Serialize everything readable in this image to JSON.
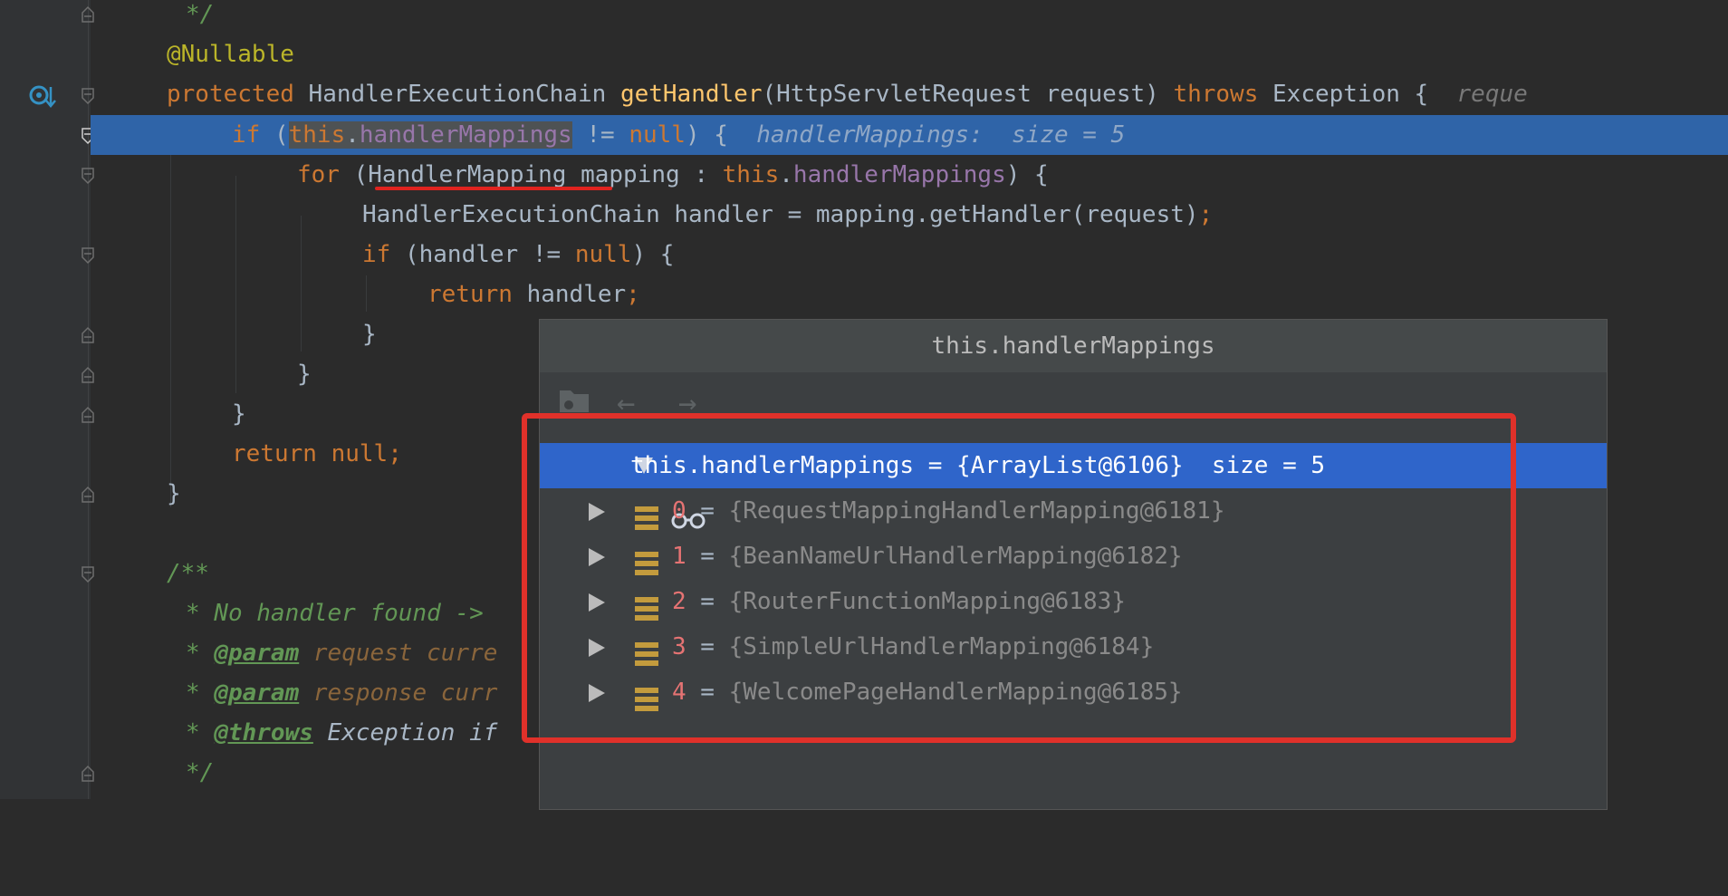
{
  "editor": {
    "lines": {
      "l0": "*/",
      "l1_annotation": "@Nullable",
      "l2": {
        "kw_protected": "protected",
        "type": "HandlerExecutionChain",
        "method": "getHandler",
        "params": "(HttpServletRequest request)",
        "kw_throws": "throws",
        "exc": "Exception {",
        "hint": "reque"
      },
      "l3": {
        "kw_if": "if",
        "paren": "(",
        "this": "this",
        "dot": ".",
        "field": "handlerMappings",
        "neq": "!=",
        "null": "null",
        "close": ") {",
        "hint": "handlerMappings:  size = 5"
      },
      "l4": {
        "kw_for": "for",
        "type_paren": "(",
        "type": "HandlerMapping",
        "rest": "mapping :",
        "this": "this",
        "dot": ".",
        "field": "handlerMappings",
        "close": ") {"
      },
      "l5": {
        "text": "HandlerExecutionChain handler = mapping.getHandler(request)",
        "semi": ";"
      },
      "l6": {
        "kw_if": "if",
        "mid": "(handler != ",
        "null": "null",
        "close": ") {"
      },
      "l7": {
        "kw_return": "return",
        "rest": "handler",
        "semi": ";"
      },
      "l8": "}",
      "l9": "}",
      "l10": "}",
      "l11": {
        "kw_return": "return",
        "null": "null",
        "semi": ";"
      },
      "l12": "}",
      "l14": "/**",
      "l15": "* No handler found ->",
      "l16": {
        "star": "*",
        "tag": "@param",
        "rest": "request curre"
      },
      "l17": {
        "star": "*",
        "tag": "@param",
        "rest": "response curr"
      },
      "l18": {
        "star": "*",
        "tag": "@throws",
        "rest": "Exception if"
      },
      "l19": "*/"
    }
  },
  "popup": {
    "title": "this.handlerMappings",
    "toolbar": {
      "back": "←",
      "forward": "→"
    },
    "root": {
      "name": "this.handlerMappings",
      "eq": " = ",
      "value": "{ArrayList@6106}",
      "size": "size = 5"
    },
    "items": [
      {
        "index": "0",
        "value": "{RequestMappingHandlerMapping@6181}"
      },
      {
        "index": "1",
        "value": "{BeanNameUrlHandlerMapping@6182}"
      },
      {
        "index": "2",
        "value": "{RouterFunctionMapping@6183}"
      },
      {
        "index": "3",
        "value": "{SimpleUrlHandlerMapping@6184}"
      },
      {
        "index": "4",
        "value": "{WelcomePageHandlerMapping@6185}"
      }
    ],
    "eq": " = "
  },
  "colors": {
    "background": "#2b2b2b",
    "selection": "#2f64a8",
    "tree_selection": "#2f65ca",
    "highlight_box": "#e0312a",
    "keyword": "#cc7832"
  }
}
